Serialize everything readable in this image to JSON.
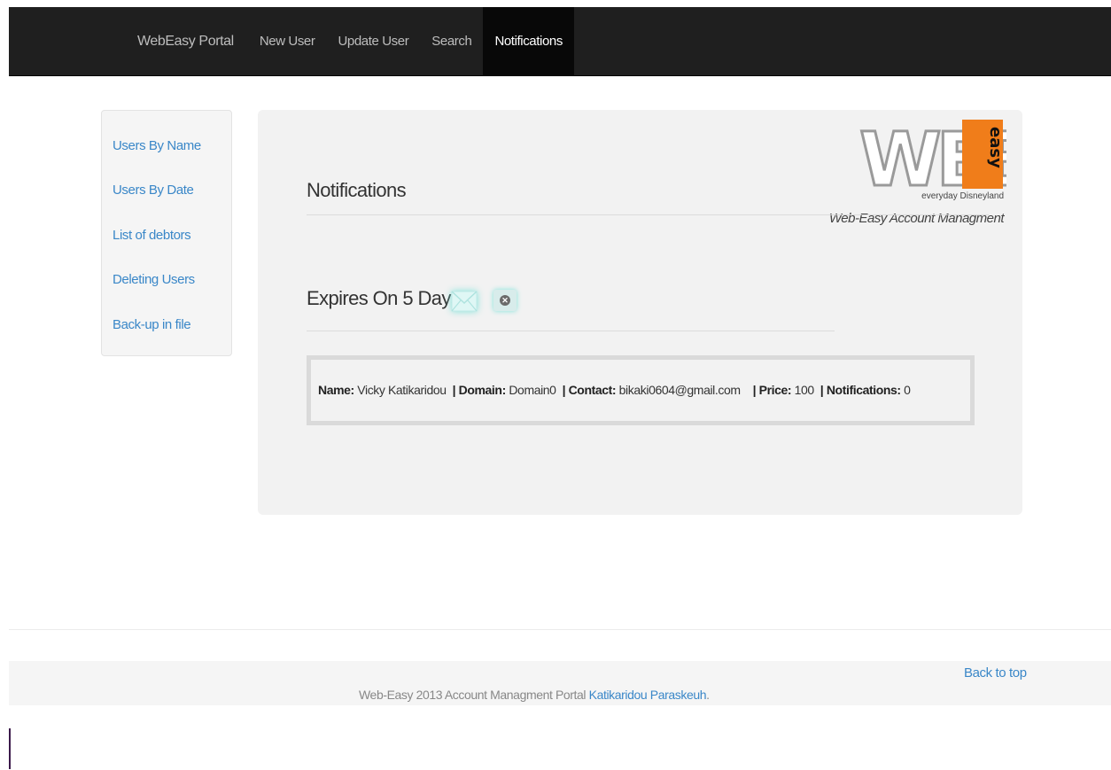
{
  "nav": {
    "brand": "WebEasy Portal",
    "items": [
      "New User",
      "Update User",
      "Search",
      "Notifications"
    ],
    "active": "Notifications"
  },
  "sidebar": {
    "items": [
      "Users By Name",
      "Users By Date",
      "List of debtors",
      "Deleting Users",
      "Back-up in file"
    ]
  },
  "logo": {
    "letters": "WEB",
    "word": "easy",
    "tagline": "everyday Disneyland",
    "subtitle": "Web-Easy Account Managment"
  },
  "main": {
    "title": "Notifications",
    "section_title": "Expires On 5 Days",
    "mail_icon": "envelope-icon",
    "close_icon": "close-icon",
    "record": {
      "name_label": "Name:",
      "name": "Vicky Katikaridou",
      "domain_label": "Domain:",
      "domain": "Domain0",
      "contact_label": "Contact:",
      "contact": "bikaki0604@gmail.com",
      "price_label": "Price:",
      "price": "100",
      "notifications_label": "Notifications:",
      "notifications": "0",
      "separator": "|"
    }
  },
  "footer": {
    "back_to_top": "Back to top",
    "text": "Web-Easy 2013 Account Managment Portal",
    "author": "Katikaridou Paraskeuh",
    "end": "."
  },
  "colors": {
    "navbar": "#1f1f1f",
    "nav_active": "#080808",
    "link": "#3a87c8",
    "logo_orange": "#f07d1a",
    "panel": "#f2f2f2"
  }
}
